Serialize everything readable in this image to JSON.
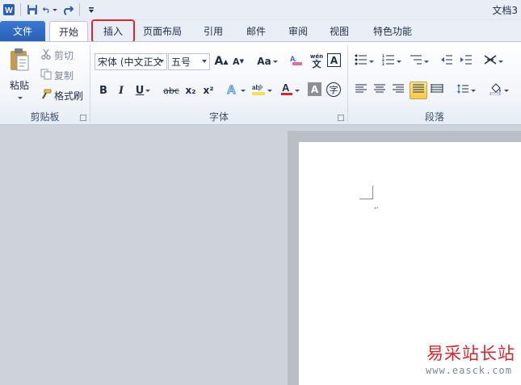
{
  "window": {
    "title": "文档3"
  },
  "quick_access": {
    "icons": [
      "word-logo-icon",
      "save-icon",
      "undo-icon",
      "redo-icon",
      "customize-icon"
    ]
  },
  "tabs": {
    "file": "文件",
    "items": [
      {
        "label": "开始",
        "state": "active"
      },
      {
        "label": "插入",
        "state": "highlighted"
      },
      {
        "label": "页面布局"
      },
      {
        "label": "引用"
      },
      {
        "label": "邮件"
      },
      {
        "label": "审阅"
      },
      {
        "label": "视图"
      },
      {
        "label": "特色功能"
      }
    ]
  },
  "clipboard": {
    "label": "剪贴板",
    "paste": "粘贴",
    "cut": "剪切",
    "copy": "复制",
    "format_painter": "格式刷"
  },
  "font": {
    "label": "字体",
    "font_name": "宋体 (中文正文",
    "font_size": "五号",
    "grow": "A",
    "shrink": "A",
    "change_case": "Aa",
    "bold": "B",
    "italic": "I",
    "underline": "U",
    "strike": "abc",
    "subscript": "x₂",
    "superscript": "x²",
    "font_color_hex": "#d9262d",
    "highlight_hex": "#f4e04d",
    "phonetic_text": "wén"
  },
  "paragraph": {
    "label": "段落"
  },
  "watermark": {
    "name": "易采站长站",
    "url": "www.easck.com"
  }
}
